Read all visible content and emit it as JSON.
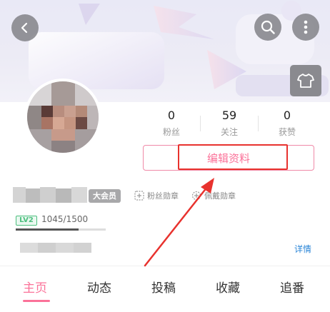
{
  "header": {
    "back_icon": "back-arrow-icon",
    "search_icon": "search-icon",
    "more_icon": "more-vertical-icon",
    "skin_icon": "tshirt-icon"
  },
  "profile": {
    "stats": [
      {
        "value": "0",
        "label": "粉丝"
      },
      {
        "value": "59",
        "label": "关注"
      },
      {
        "value": "0",
        "label": "获赞"
      }
    ],
    "edit_label": "编辑资料",
    "vip_label": "大会员",
    "fan_medal_label": "粉丝勋章",
    "wear_medal_label": "佩戴勋章",
    "level_label": "LV2",
    "exp_text": "1045/1500",
    "exp_fraction": 0.6967,
    "detail_label": "详情"
  },
  "tabs": [
    {
      "label": "主页",
      "active": true
    },
    {
      "label": "动态",
      "active": false
    },
    {
      "label": "投稿",
      "active": false
    },
    {
      "label": "收藏",
      "active": false
    },
    {
      "label": "追番",
      "active": false
    }
  ],
  "colors": {
    "accent_pink": "#fb7299",
    "annotation_red": "#e8322e",
    "level_green": "#4cbf7e",
    "link_blue": "#2b86d7"
  }
}
